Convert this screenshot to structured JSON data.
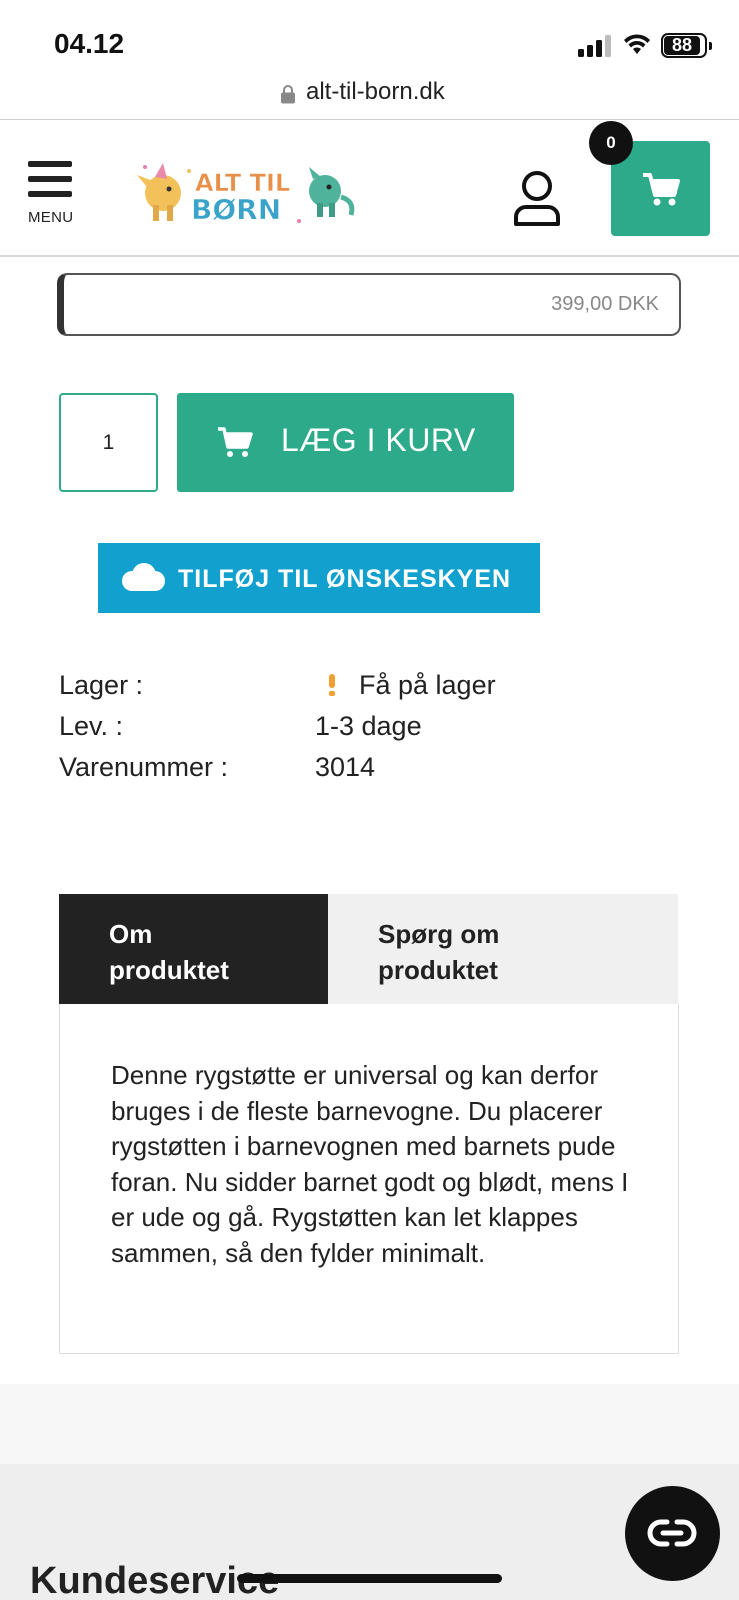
{
  "status_bar": {
    "time": "04.12",
    "battery": "88"
  },
  "browser": {
    "url": "alt-til-born.dk"
  },
  "header": {
    "menu_label": "MENU",
    "cart_count": "0",
    "logo_text_line1": "ALT TIL",
    "logo_text_line2": "BØRN"
  },
  "product": {
    "price": "399,00 DKK",
    "quantity": "1",
    "add_to_cart_label": "LÆG I KURV",
    "wishlist_label": "TILFØJ TIL ØNSKESKYEN",
    "info": [
      {
        "label": "Lager :",
        "value": "Få på lager"
      },
      {
        "label": "Lev. :",
        "value": "1-3 dage"
      },
      {
        "label": "Varenummer :",
        "value": "3014"
      }
    ]
  },
  "tabs": {
    "about_label": "Om produktet",
    "ask_label": "Spørg om produktet",
    "description": "Denne rygstøtte er universal og kan derfor bruges i de fleste barnevogne. Du placerer rygstøtten i barnevognen med barnets pude foran. Nu sidder barnet godt og blødt, mens I er ude og gå. Rygstøtten kan let klappes sammen, så den fylder minimalt."
  },
  "footer": {
    "heading": "Kundeservice"
  },
  "colors": {
    "accent": "#2daa89",
    "wishlist": "#12a0cf",
    "dark": "#222222"
  }
}
